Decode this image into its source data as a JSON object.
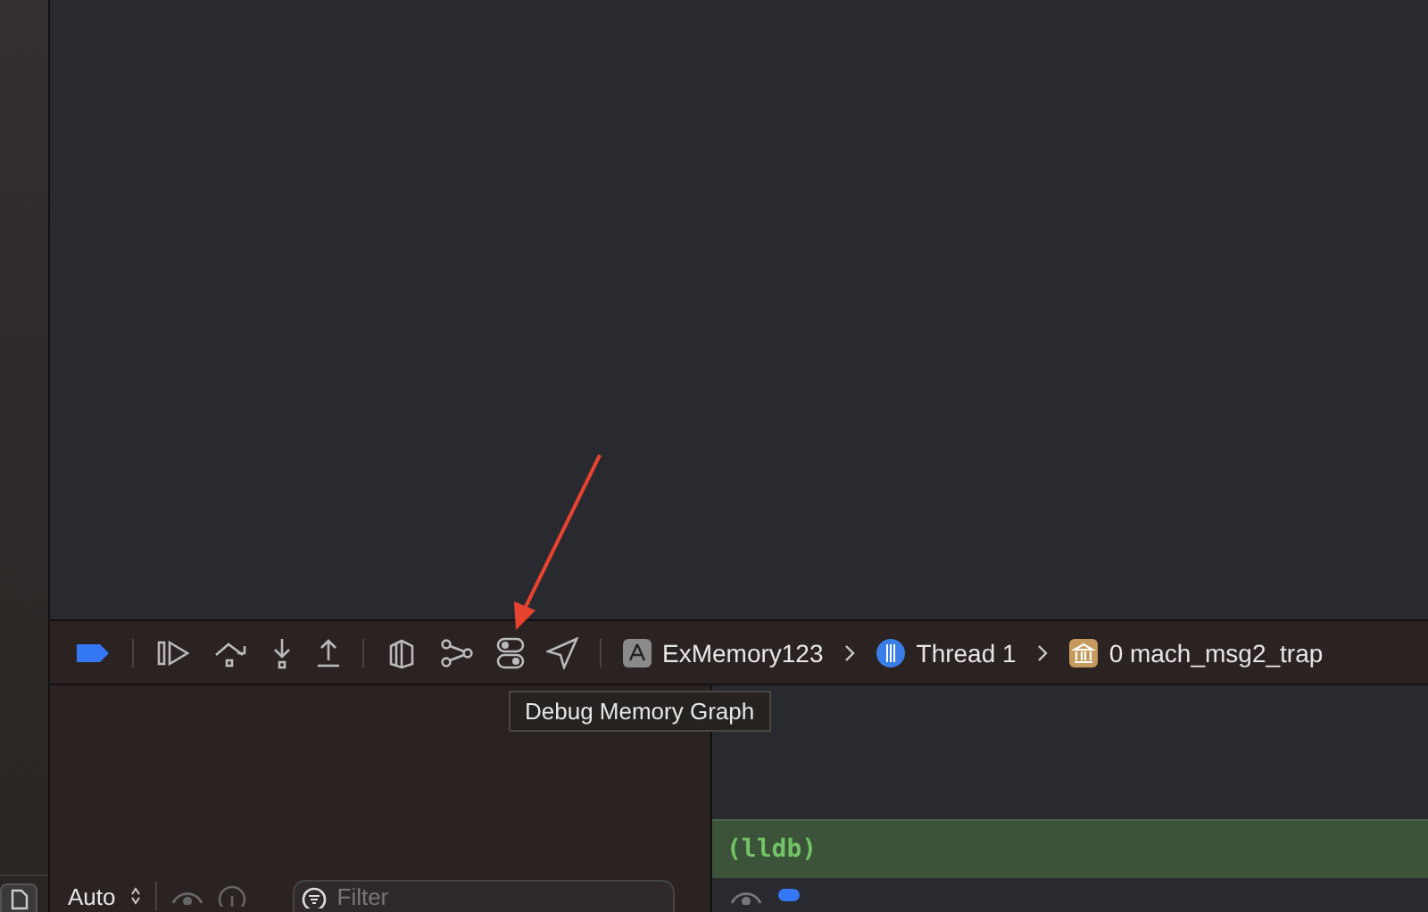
{
  "debug_bar": {
    "breakpoints_active": true,
    "breadcrumbs": [
      {
        "kind": "app",
        "label": "ExMemory123"
      },
      {
        "kind": "thread",
        "label": "Thread 1"
      },
      {
        "kind": "frame",
        "label": "0 mach_msg2_trap"
      }
    ]
  },
  "tooltip": {
    "text": "Debug Memory Graph"
  },
  "variables_pane": {
    "scope": "Auto",
    "filter": {
      "placeholder": "Filter"
    }
  },
  "console": {
    "prompt": "(lldb)"
  }
}
